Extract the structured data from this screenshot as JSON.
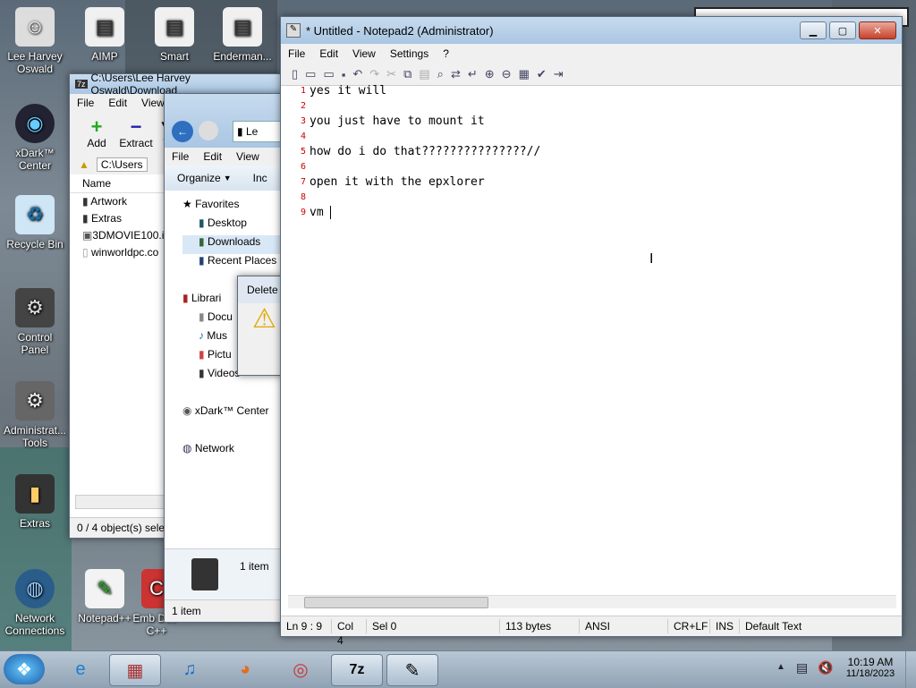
{
  "desktop_icons": [
    {
      "label": "Lee Harvey Oswald",
      "icon": "user-icon"
    },
    {
      "label": "AIMP",
      "icon": "shortcut-icon"
    },
    {
      "label": "Smart",
      "icon": "shortcut-icon"
    },
    {
      "label": "Enderman...",
      "icon": "shortcut-icon"
    },
    {
      "label": "xDark™ Center",
      "icon": "xdark-icon"
    },
    {
      "label": "Recycle Bin",
      "icon": "recycle-bin-icon"
    },
    {
      "label": "Control Panel",
      "icon": "control-panel-icon"
    },
    {
      "label": "Administrat... Tools",
      "icon": "admin-tools-icon"
    },
    {
      "label": "Extras",
      "icon": "folder-icon"
    },
    {
      "label": "Network Connections",
      "icon": "network-icon"
    },
    {
      "label": "Notepad++",
      "icon": "notepadpp-icon"
    },
    {
      "label": "Emb Dev-C++",
      "icon": "devcpp-icon"
    }
  ],
  "sevenzip": {
    "title": "C:\\Users\\Lee Harvey Oswald\\Download",
    "menu": [
      "File",
      "Edit",
      "View"
    ],
    "toolbar": {
      "add": "Add",
      "extract": "Extract",
      "test": "T"
    },
    "path": "C:\\Users",
    "column_name": "Name",
    "files": [
      "Artwork",
      "Extras",
      "3DMOVIE100.i",
      "winworldpc.co"
    ],
    "status": "0 / 4 object(s) select"
  },
  "explorer": {
    "menu": [
      "File",
      "Edit",
      "View"
    ],
    "organize": "Organize",
    "include": "Inc",
    "crumb": "Le",
    "nav": [
      "Favorites",
      "Desktop",
      "Downloads",
      "Recent Places",
      "Librari",
      "Docu",
      "Mus",
      "Pictu",
      "Videos",
      "xDark™ Center",
      "Network"
    ],
    "details_count": "1 item",
    "status": "1 item"
  },
  "delete_dialog": {
    "title": "Delete"
  },
  "notepad": {
    "title": "* Untitled - Notepad2 (Administrator)",
    "menu": [
      "File",
      "Edit",
      "View",
      "Settings",
      "?"
    ],
    "lines": [
      {
        "n": "1",
        "t": "yes it will"
      },
      {
        "n": "2",
        "t": ""
      },
      {
        "n": "3",
        "t": "you just have to mount it"
      },
      {
        "n": "4",
        "t": ""
      },
      {
        "n": "5",
        "t": "how do i do that???????????????//"
      },
      {
        "n": "6",
        "t": ""
      },
      {
        "n": "7",
        "t": "open it with the epxlorer"
      },
      {
        "n": "8",
        "t": ""
      },
      {
        "n": "9",
        "t": "vm "
      }
    ],
    "status": {
      "pos": "Ln 9 : 9",
      "col": "Col 4",
      "sel": "Sel 0",
      "bytes": "113 bytes",
      "enc": "ANSI",
      "eol": "CR+LF",
      "ins": "INS",
      "scheme": "Default Text"
    }
  },
  "taskbar": {
    "time": "10:19 AM",
    "date": "11/18/2023",
    "items": [
      "start-orb-icon",
      "internet-explorer-icon",
      "archive-icon",
      "music-icon",
      "firefox-icon",
      "chrome-icon",
      "7zip-icon",
      "notepad2-icon"
    ]
  }
}
